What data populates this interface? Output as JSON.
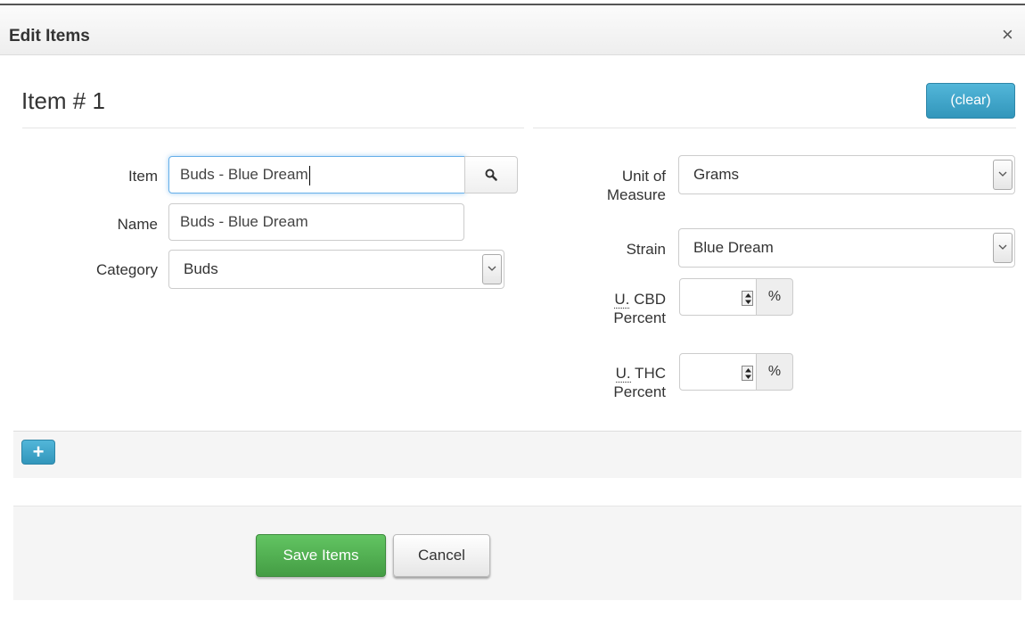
{
  "modal": {
    "title": "Edit Items",
    "close_glyph": "×"
  },
  "item": {
    "heading": "Item # 1",
    "clear_label": "(clear)",
    "fields": {
      "item_label": "Item",
      "item_value": "Buds - Blue Dream",
      "name_label": "Name",
      "name_value": "Buds - Blue Dream",
      "category_label": "Category",
      "category_value": "Buds",
      "uom_label_line1": "Unit of",
      "uom_label_line2": "Measure",
      "uom_value": "Grams",
      "strain_label": "Strain",
      "strain_value": "Blue Dream",
      "cbd_label_abbr": "U.",
      "cbd_label_rest": " CBD",
      "cbd_label_line2": "Percent",
      "cbd_value": "",
      "thc_label_abbr": "U.",
      "thc_label_rest": " THC",
      "thc_label_line2": "Percent",
      "thc_value": "",
      "percent_symbol": "%"
    },
    "icons": {
      "search": "search-icon",
      "dropdown": "chevron-down-icon",
      "spinner": "spinner-arrows-icon",
      "add": "plus-icon"
    }
  },
  "add_button_glyph": "+",
  "footer": {
    "save_label": "Save Items",
    "cancel_label": "Cancel"
  },
  "colors": {
    "info_button": "#3d9fc6",
    "success_button": "#4cae4c",
    "focus_border": "#66afe9"
  }
}
